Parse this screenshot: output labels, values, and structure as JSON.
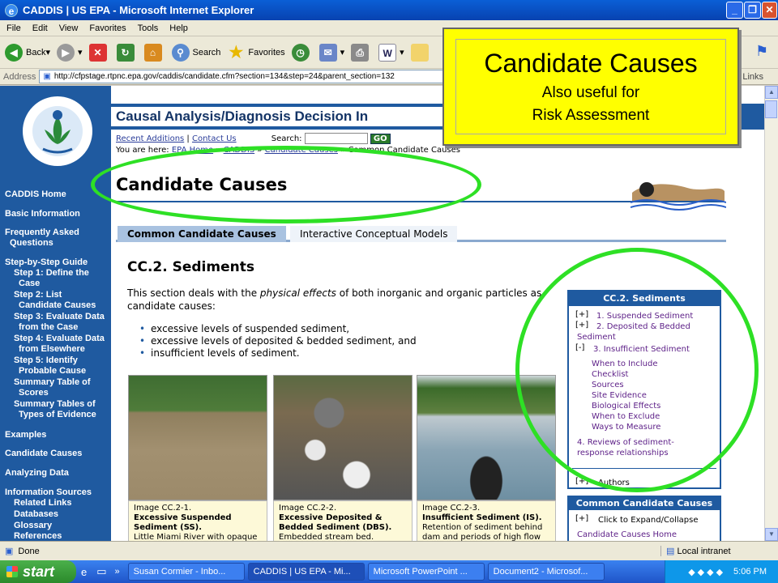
{
  "window": {
    "title": "CADDIS | US EPA - Microsoft Internet Explorer"
  },
  "menu": [
    "File",
    "Edit",
    "View",
    "Favorites",
    "Tools",
    "Help"
  ],
  "toolbar": {
    "back": "Back",
    "search": "Search",
    "favorites": "Favorites"
  },
  "address": {
    "label": "Address",
    "url": "http://cfpstage.rtpnc.epa.gov/caddis/candidate.cfm?section=134&step=24&parent_section=132",
    "links": "Links"
  },
  "site": {
    "header_title": "Causal Analysis/Diagnosis Decision In",
    "recent": "Recent Additions",
    "contact": "Contact Us",
    "search_label": "Search:",
    "go": "GO",
    "crumb_prefix": "You are here:",
    "crumb_1": "EPA Home",
    "crumb_2": "CADDIS",
    "crumb_3": "Candidate Causes",
    "crumb_4": "Common Candidate Causes",
    "page_title": "Candidate Causes"
  },
  "nav": [
    "CADDIS Home",
    "Basic Information",
    "Frequently Asked",
    "Questions",
    "Step-by-Step Guide",
    "Step 1: Define the",
    "Case",
    "Step 2: List",
    "Candidate Causes",
    "Step 3: Evaluate Data",
    "from the Case",
    "Step 4: Evaluate Data",
    "from Elsewhere",
    "Step 5: Identify",
    "Probable Cause",
    "Summary Table of",
    "Scores",
    "Summary Tables of",
    "Types of Evidence",
    "Examples",
    "Candidate Causes",
    "Analyzing Data",
    "Information Sources",
    "Related Links",
    "Databases",
    "Glossary",
    "References"
  ],
  "tabs": {
    "tab1": "Common Candidate Causes",
    "tab2": "Interactive Conceptual Models"
  },
  "content": {
    "heading": "CC.2. Sediments",
    "intro_1": "This section deals with the ",
    "intro_em": "physical effects",
    "intro_2": " of both inorganic and organic particles as candidate causes:",
    "bullets": [
      "excessive levels of suspended sediment,",
      "excessive levels of deposited & bedded sediment, and",
      "insufficient levels of sediment."
    ]
  },
  "captions": [
    {
      "id": "Image CC.2-1.",
      "title": "Excessive Suspended Sediment (SS).",
      "desc": "Little Miami River with opaque"
    },
    {
      "id": "Image CC.2-2.",
      "title": "Excessive Deposited & Bedded Sediment (DBS).",
      "desc": "Embedded stream bed."
    },
    {
      "id": "Image CC.2-3.",
      "title": "Insufficient Sediment (IS).",
      "desc": "Retention of sediment behind dam and periods of high flow"
    }
  ],
  "sidebox": {
    "head": "CC.2. Sediments",
    "plus": "[+]",
    "minus": "[-]",
    "i1": "1. Suspended Sediment",
    "i2a": "2. Deposited & Bedded",
    "i2b": "Sediment",
    "i3": "3. Insufficient Sediment",
    "sub": [
      "When to Include",
      "Checklist",
      "Sources",
      "Site Evidence",
      "Biological Effects",
      "When to Exclude",
      "Ways to Measure"
    ],
    "i4a": "4. Reviews of sediment-",
    "i4b": "response relationships",
    "authors": "Authors"
  },
  "sidebox2": {
    "head": "Common Candidate Causes",
    "expand": "Click to Expand/Collapse",
    "home": "Candidate Causes Home"
  },
  "callout": {
    "line1": "Candidate Causes",
    "line2": "Also useful for",
    "line3": "Risk Assessment"
  },
  "status": {
    "done": "Done",
    "zone": "Local intranet"
  },
  "taskbar": {
    "start": "start",
    "t1": "Susan Cormier - Inbo...",
    "t2": "CADDIS | US EPA - Mi...",
    "t3": "Microsoft PowerPoint ...",
    "t4": "Document2 - Microsof...",
    "clock": "5:06 PM"
  }
}
